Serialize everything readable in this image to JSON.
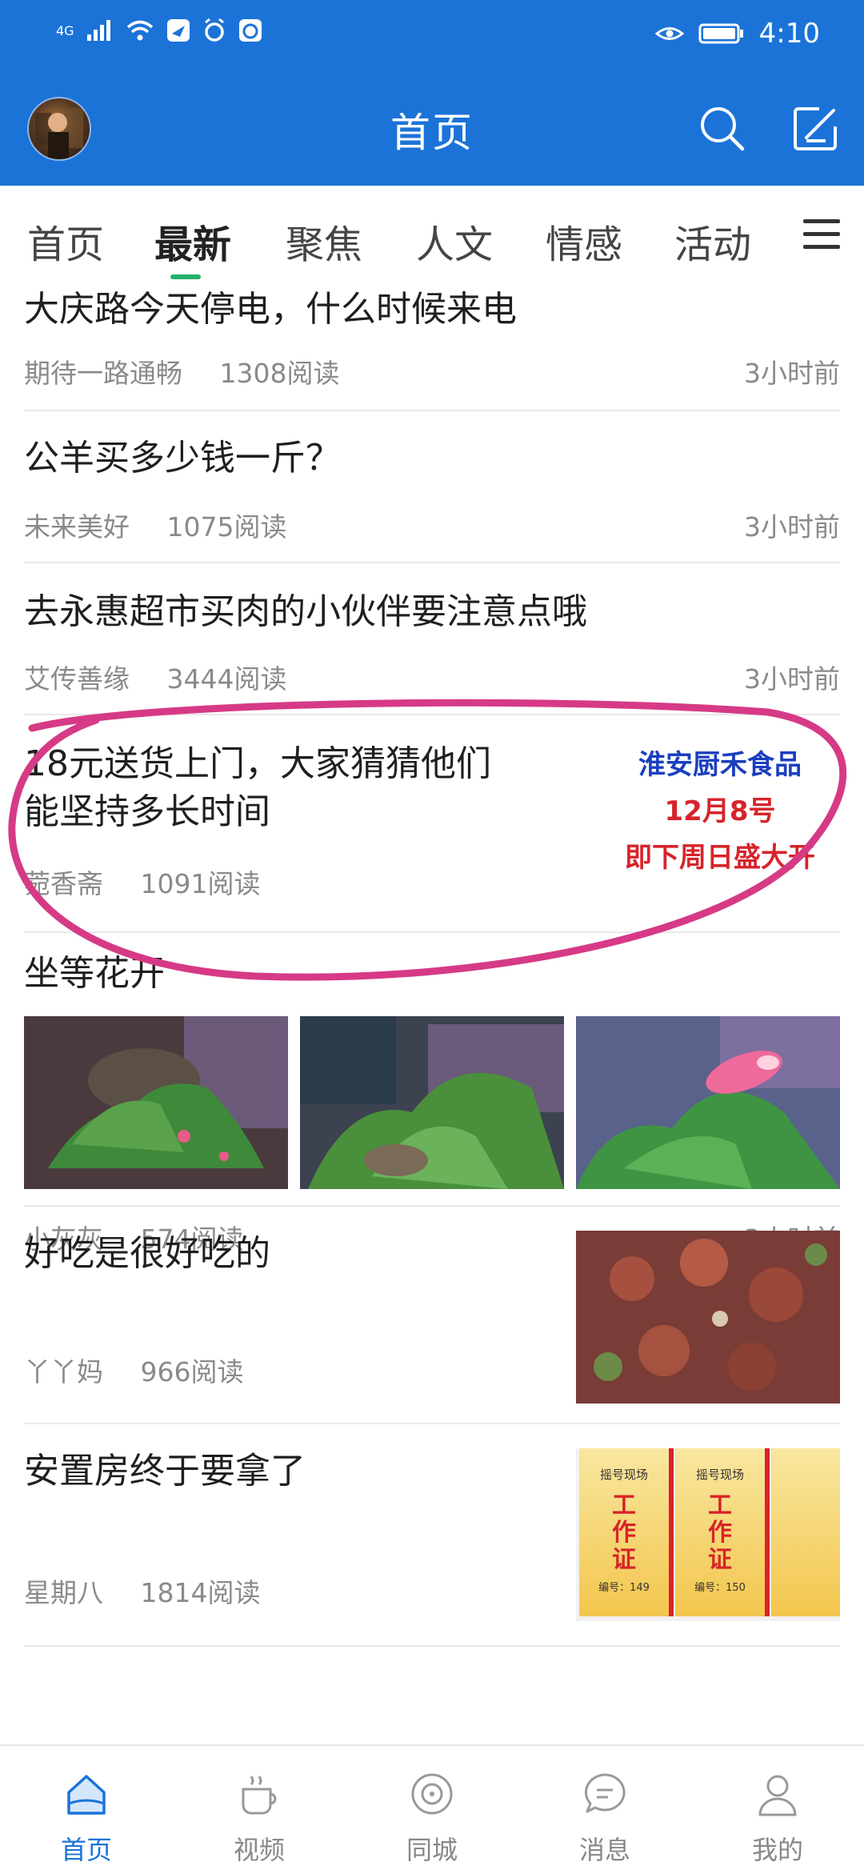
{
  "status": {
    "network": "4G",
    "time": "4:10"
  },
  "header": {
    "title": "首页"
  },
  "tabs": [
    "首页",
    "最新",
    "聚焦",
    "人文",
    "情感",
    "活动"
  ],
  "active_tab": "最新",
  "feed": [
    {
      "title": "大庆路今天停电，什么时候来电",
      "author": "期待一路通畅",
      "reads": "1308阅读",
      "time": "3小时前"
    },
    {
      "title": "公羊买多少钱一斤？",
      "author": "未来美好",
      "reads": "1075阅读",
      "time": "3小时前"
    },
    {
      "title": "去永惠超市买肉的小伙伴要注意点哦",
      "author": "艾传善缘",
      "reads": "3444阅读",
      "time": "3小时前"
    },
    {
      "title_line1": "18元送货上门，大家猜猜他们",
      "title_line2": "能坚持多长时间",
      "author": "菀香斋",
      "reads": "1091阅读",
      "ad_line1": "淮安厨禾食品",
      "ad_line2": "12月8号",
      "ad_line3": "即下周日盛大开"
    },
    {
      "title": "坐等花开",
      "author": "小灰灰",
      "reads": "574阅读",
      "time": "3小时前"
    },
    {
      "title": "好吃是很好吃的",
      "author": "丫丫妈",
      "reads": "966阅读"
    },
    {
      "title": "安置房终于要拿了",
      "author": "星期八",
      "reads": "1814阅读",
      "thumb_line1": "摇号现场",
      "thumb_line2": "工作证",
      "thumb_no1": "编号：149",
      "thumb_no2": "编号：150"
    }
  ],
  "bottom_nav": [
    {
      "label": "首页",
      "icon": "home-icon"
    },
    {
      "label": "视频",
      "icon": "coffee-cup-icon"
    },
    {
      "label": "同城",
      "icon": "target-icon"
    },
    {
      "label": "消息",
      "icon": "chat-bubble-icon"
    },
    {
      "label": "我的",
      "icon": "user-icon"
    }
  ],
  "colors": {
    "brand": "#1b73d8",
    "tab_indicator": "#22b168",
    "annotation": "#d63a86"
  }
}
